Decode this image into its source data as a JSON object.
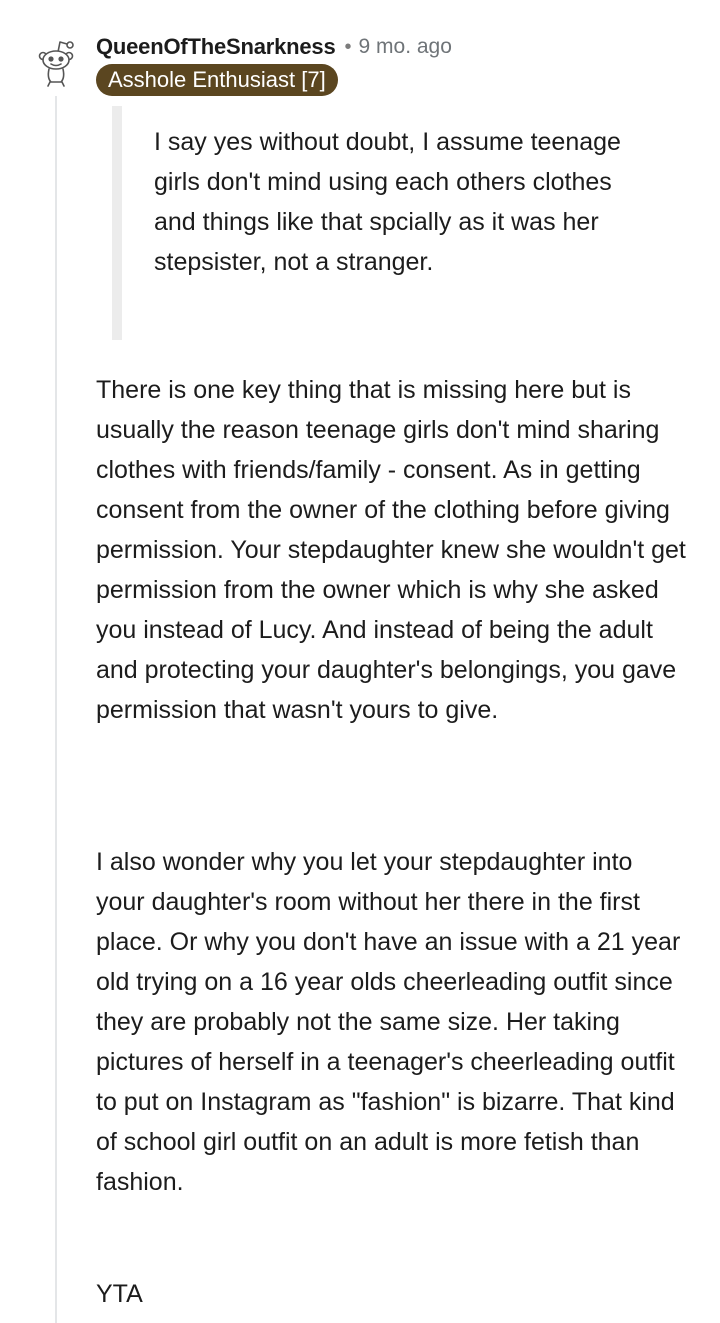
{
  "comment": {
    "username": "QueenOfTheSnarkness",
    "separator": "•",
    "time": "9 mo. ago",
    "flair": "Asshole Enthusiast [7]",
    "quote": "I say yes without doubt, I assume teenage girls don't mind using each others clothes and things like that spcially as it was her stepsister, not a stranger.",
    "paragraphs": [
      "There is one key thing that is missing here but is usually the reason teenage girls don't mind sharing clothes with friends/family - consent. As in getting consent from the owner of the clothing before giving permission. Your stepdaughter knew she wouldn't get permission from the owner which is why she asked you instead of Lucy. And instead of being the adult and protecting your daughter's belongings, you gave permission that wasn't yours to give.",
      "I also wonder why you let your stepdaughter into your daughter's room without her there in the first place. Or why you don't have an issue with a 21 year old trying on a 16 year olds cheerleading outfit since they are probably not the same size. Her taking pictures of herself in a teenager's cheerleading outfit to put on Instagram as \"fashion\" is bizarre. That kind of school girl outfit on an adult is more fetish than fashion.",
      "YTA"
    ]
  },
  "icons": {
    "avatar": "snoo-avatar-icon"
  },
  "colors": {
    "flair_background": "#5b4620",
    "flair_text": "#ffffff",
    "thread_line": "#e4e6e8",
    "quote_bar": "#ececec",
    "meta_text": "#6f7478"
  }
}
